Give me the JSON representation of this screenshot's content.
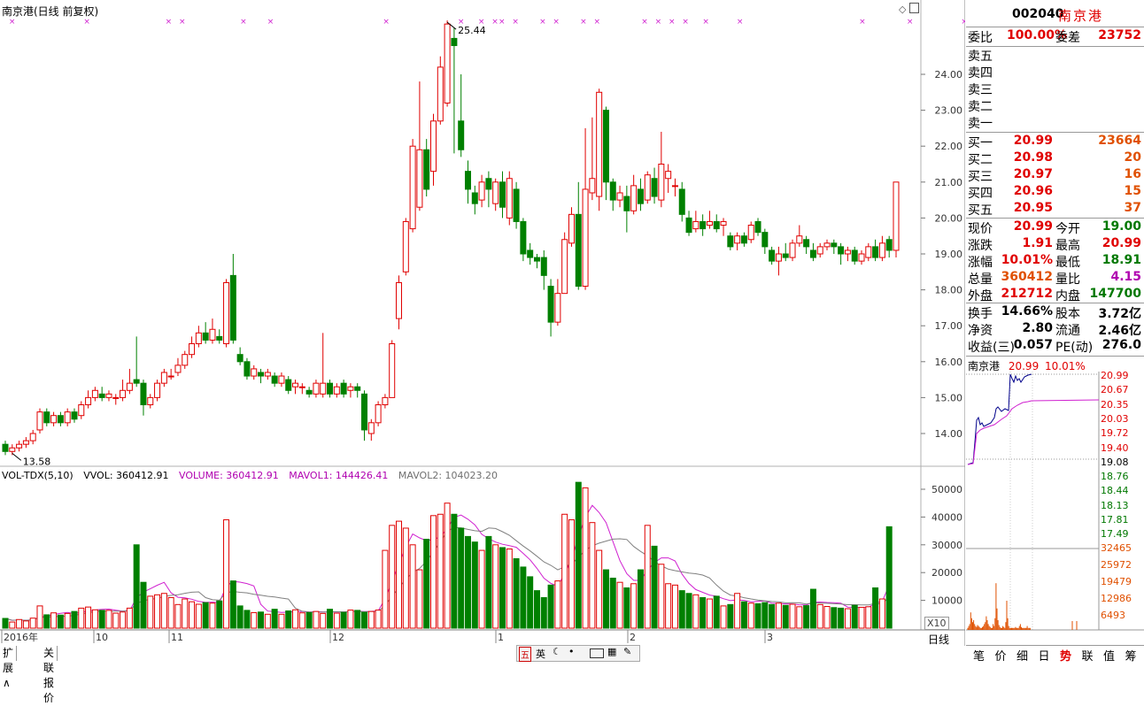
{
  "header": {
    "title": "南京港(日线 前复权)",
    "top_right_icons": [
      "diamond-icon",
      "window-icon"
    ]
  },
  "price_axis": [
    "24.00",
    "23.00",
    "22.00",
    "21.00",
    "20.00",
    "19.00",
    "18.00",
    "17.00",
    "16.00",
    "15.00",
    "14.00"
  ],
  "annotations": {
    "high": "25.44",
    "low": "13.58"
  },
  "volume_header": {
    "name": "VOL-TDX(5,10)",
    "vvol": "VVOL: 360412.91",
    "volume": "VOLUME: 360412.91",
    "mavol1": "MAVOL1: 144426.41",
    "mavol2": "MAVOL2: 104023.20"
  },
  "volume_axis": [
    "50000",
    "40000",
    "30000",
    "20000",
    "10000"
  ],
  "volume_unit": "X10",
  "date_axis": [
    "2016年",
    "10",
    "11",
    "12",
    "1",
    "2",
    "3"
  ],
  "period_label": "日线",
  "bottom_tabs": [
    "扩展∧",
    "关联报价"
  ],
  "toolbar_icons": [
    "五",
    "英"
  ],
  "chart_data": {
    "type": "candlestick",
    "title": "南京港(日线 前复权)",
    "ylim": [
      13.3,
      25.6
    ],
    "candles": [
      [
        13.7,
        13.5,
        13.8,
        13.4
      ],
      [
        13.5,
        13.6,
        13.7,
        13.4
      ],
      [
        13.6,
        13.7,
        13.8,
        13.5
      ],
      [
        13.7,
        13.8,
        13.9,
        13.6
      ],
      [
        13.8,
        14.0,
        14.1,
        13.7
      ],
      [
        14.1,
        14.6,
        14.7,
        14.0
      ],
      [
        14.6,
        14.3,
        14.7,
        14.2
      ],
      [
        14.3,
        14.5,
        14.6,
        14.2
      ],
      [
        14.5,
        14.3,
        14.6,
        14.2
      ],
      [
        14.3,
        14.6,
        14.7,
        14.2
      ],
      [
        14.6,
        14.4,
        14.7,
        14.3
      ],
      [
        14.5,
        14.8,
        14.9,
        14.4
      ],
      [
        14.8,
        15.0,
        15.2,
        14.7
      ],
      [
        15.0,
        15.2,
        15.3,
        14.9
      ],
      [
        15.1,
        15.0,
        15.3,
        14.9
      ],
      [
        15.0,
        15.1,
        15.2,
        14.9
      ],
      [
        15.0,
        15.0,
        15.1,
        14.8
      ],
      [
        15.0,
        15.2,
        15.5,
        14.9
      ],
      [
        15.2,
        15.4,
        15.8,
        15.1
      ],
      [
        15.5,
        15.4,
        16.7,
        15.3
      ],
      [
        15.4,
        14.8,
        15.5,
        14.5
      ],
      [
        14.8,
        15.0,
        15.1,
        14.7
      ],
      [
        15.0,
        15.4,
        15.5,
        14.9
      ],
      [
        15.4,
        15.7,
        15.8,
        15.3
      ],
      [
        15.6,
        15.6,
        15.8,
        15.5
      ],
      [
        15.7,
        15.9,
        16.1,
        15.6
      ],
      [
        15.9,
        16.2,
        16.3,
        15.8
      ],
      [
        16.2,
        16.5,
        16.7,
        16.1
      ],
      [
        16.5,
        16.8,
        17.0,
        16.4
      ],
      [
        16.8,
        16.6,
        17.1,
        16.5
      ],
      [
        16.6,
        16.9,
        17.2,
        16.5
      ],
      [
        16.7,
        16.6,
        16.9,
        16.5
      ],
      [
        16.5,
        18.2,
        18.3,
        16.4
      ],
      [
        18.4,
        16.6,
        19.0,
        16.5
      ],
      [
        16.2,
        16.0,
        16.4,
        15.9
      ],
      [
        16.0,
        15.6,
        16.1,
        15.5
      ],
      [
        15.6,
        15.8,
        15.9,
        15.5
      ],
      [
        15.7,
        15.6,
        15.8,
        15.4
      ],
      [
        15.6,
        15.7,
        15.8,
        15.5
      ],
      [
        15.6,
        15.4,
        15.7,
        15.3
      ],
      [
        15.4,
        15.6,
        15.7,
        15.3
      ],
      [
        15.5,
        15.2,
        15.6,
        15.1
      ],
      [
        15.3,
        15.4,
        15.5,
        15.1
      ],
      [
        15.3,
        15.3,
        15.4,
        15.1
      ],
      [
        15.2,
        15.1,
        15.3,
        15.0
      ],
      [
        15.1,
        15.4,
        15.5,
        15.0
      ],
      [
        15.1,
        15.4,
        16.8,
        15.0
      ],
      [
        15.4,
        15.1,
        15.5,
        15.0
      ],
      [
        15.1,
        15.3,
        15.4,
        15.0
      ],
      [
        15.4,
        15.1,
        15.5,
        15.0
      ],
      [
        15.2,
        15.3,
        15.4,
        15.0
      ],
      [
        15.3,
        15.2,
        15.4,
        15.0
      ],
      [
        15.1,
        14.1,
        15.2,
        13.8
      ],
      [
        14.0,
        14.3,
        14.4,
        13.8
      ],
      [
        14.3,
        14.8,
        14.9,
        14.2
      ],
      [
        14.8,
        15.0,
        15.1,
        14.7
      ],
      [
        15.0,
        16.5,
        16.6,
        15.0
      ],
      [
        17.2,
        18.2,
        18.4,
        16.9
      ],
      [
        18.5,
        19.9,
        20.0,
        18.4
      ],
      [
        19.7,
        22.0,
        22.2,
        19.6
      ],
      [
        20.3,
        21.9,
        23.8,
        20.2
      ],
      [
        21.9,
        20.8,
        22.2,
        20.6
      ],
      [
        21.3,
        22.7,
        22.9,
        20.9
      ],
      [
        22.7,
        24.2,
        24.5,
        22.6
      ],
      [
        23.2,
        25.4,
        25.5,
        23.1
      ],
      [
        25.0,
        24.8,
        25.3,
        21.8
      ],
      [
        22.7,
        21.9,
        24.0,
        21.7
      ],
      [
        21.3,
        20.8,
        21.6,
        20.4
      ],
      [
        20.7,
        20.4,
        20.9,
        20.1
      ],
      [
        20.5,
        21.0,
        21.2,
        20.3
      ],
      [
        21.1,
        20.8,
        21.3,
        20.3
      ],
      [
        20.4,
        21.0,
        21.1,
        20.2
      ],
      [
        21.0,
        20.3,
        21.3,
        20.0
      ],
      [
        20.0,
        21.1,
        21.3,
        19.8
      ],
      [
        20.8,
        19.9,
        21.0,
        19.7
      ],
      [
        19.9,
        19.0,
        20.0,
        18.8
      ],
      [
        19.1,
        18.9,
        19.3,
        18.7
      ],
      [
        18.9,
        18.8,
        19.0,
        18.6
      ],
      [
        18.9,
        18.4,
        19.1,
        18.0
      ],
      [
        18.1,
        17.1,
        18.3,
        16.7
      ],
      [
        17.1,
        17.9,
        18.3,
        17.0
      ],
      [
        17.9,
        19.4,
        19.6,
        17.9
      ],
      [
        19.3,
        20.1,
        20.3,
        19.2
      ],
      [
        20.1,
        18.1,
        21.0,
        18.0
      ],
      [
        18.1,
        20.8,
        22.5,
        18.0
      ],
      [
        20.7,
        21.1,
        22.8,
        20.5
      ],
      [
        20.6,
        23.5,
        23.6,
        20.2
      ],
      [
        23.0,
        21.0,
        23.1,
        20.5
      ],
      [
        21.0,
        20.5,
        21.1,
        20.2
      ],
      [
        20.5,
        20.7,
        20.9,
        20.3
      ],
      [
        20.6,
        20.2,
        20.9,
        19.6
      ],
      [
        20.2,
        20.9,
        21.2,
        20.1
      ],
      [
        20.8,
        20.4,
        21.1,
        20.2
      ],
      [
        20.5,
        21.2,
        21.3,
        20.4
      ],
      [
        21.1,
        20.6,
        21.4,
        20.4
      ],
      [
        20.5,
        21.5,
        22.4,
        20.3
      ],
      [
        21.1,
        21.3,
        21.5,
        20.7
      ],
      [
        20.9,
        20.9,
        21.1,
        20.6
      ],
      [
        20.8,
        20.1,
        21.0,
        19.9
      ],
      [
        20.0,
        19.6,
        20.2,
        19.5
      ],
      [
        19.7,
        19.9,
        20.2,
        19.6
      ],
      [
        19.9,
        19.7,
        20.1,
        19.5
      ],
      [
        19.8,
        19.9,
        20.2,
        19.7
      ],
      [
        19.9,
        19.7,
        20.1,
        19.6
      ],
      [
        19.8,
        19.9,
        20.0,
        19.5
      ],
      [
        19.5,
        19.2,
        19.6,
        19.1
      ],
      [
        19.3,
        19.5,
        19.6,
        19.1
      ],
      [
        19.5,
        19.3,
        19.6,
        19.2
      ],
      [
        19.4,
        19.8,
        19.9,
        19.3
      ],
      [
        19.9,
        19.6,
        20.0,
        19.5
      ],
      [
        19.6,
        19.2,
        19.7,
        19.0
      ],
      [
        19.1,
        18.8,
        19.2,
        18.7
      ],
      [
        18.8,
        19.0,
        19.2,
        18.4
      ],
      [
        19.0,
        18.9,
        19.3,
        18.8
      ],
      [
        18.9,
        19.3,
        19.4,
        18.8
      ],
      [
        19.3,
        19.5,
        19.8,
        19.2
      ],
      [
        19.4,
        19.2,
        19.5,
        19.0
      ],
      [
        19.1,
        18.9,
        19.3,
        18.8
      ],
      [
        19.0,
        19.2,
        19.3,
        18.9
      ],
      [
        19.2,
        19.3,
        19.4,
        19.1
      ],
      [
        19.3,
        19.2,
        19.4,
        19.0
      ],
      [
        19.2,
        19.0,
        19.3,
        18.7
      ],
      [
        19.0,
        19.1,
        19.2,
        18.8
      ],
      [
        19.1,
        18.8,
        19.2,
        18.7
      ],
      [
        18.8,
        19.0,
        19.1,
        18.7
      ],
      [
        18.9,
        19.2,
        19.3,
        18.8
      ],
      [
        19.2,
        18.9,
        19.4,
        18.8
      ],
      [
        18.9,
        19.3,
        19.5,
        18.8
      ],
      [
        19.4,
        19.1,
        19.5,
        18.9
      ],
      [
        19.1,
        21.0,
        21.0,
        18.9
      ]
    ],
    "volume": [
      3500,
      2200,
      3100,
      2600,
      3600,
      8000,
      4800,
      5500,
      4700,
      5300,
      6000,
      7200,
      7600,
      6600,
      6400,
      6400,
      5400,
      5800,
      7200,
      30000,
      16500,
      11500,
      12000,
      12500,
      11000,
      8500,
      10500,
      9500,
      8600,
      9200,
      9000,
      9800,
      39000,
      17000,
      8000,
      6400,
      5600,
      5800,
      5000,
      6800,
      5000,
      6200,
      6600,
      5500,
      5600,
      6000,
      5300,
      6800,
      5400,
      5700,
      6500,
      6400,
      5700,
      6000,
      6500,
      28000,
      37000,
      38500,
      36000,
      30000,
      21000,
      32000,
      40500,
      41000,
      45000,
      41000,
      36000,
      33000,
      31000,
      28000,
      33000,
      30000,
      29000,
      28500,
      25000,
      22000,
      18500,
      13500,
      11000,
      15500,
      17000,
      41000,
      39000,
      52500,
      50500,
      38000,
      28000,
      21000,
      18000,
      16500,
      14500,
      16000,
      21000,
      37000,
      29500,
      23000,
      16000,
      15500,
      13500,
      12500,
      12000,
      11000,
      10500,
      11500,
      8000,
      8500,
      12500,
      9500,
      9000,
      8800,
      9200,
      8500,
      9000,
      8200,
      8600,
      7700,
      8100,
      14000,
      8500,
      7800,
      7400,
      7200,
      7000,
      8200,
      7500,
      7700,
      14500,
      10500,
      36500
    ],
    "x_labels": [
      "2016年",
      "10",
      "11",
      "12",
      "1",
      "2",
      "3"
    ]
  },
  "quote": {
    "code": "002040",
    "name": "南京港",
    "weibi_label": "委比",
    "weibi": "100.00%",
    "weicha_label": "委差",
    "weicha": "23752",
    "sell_labels": [
      "卖五",
      "卖四",
      "卖三",
      "卖二",
      "卖一"
    ],
    "buy": [
      {
        "label": "买一",
        "price": "20.99",
        "vol": "23664"
      },
      {
        "label": "买二",
        "price": "20.98",
        "vol": "20"
      },
      {
        "label": "买三",
        "price": "20.97",
        "vol": "16"
      },
      {
        "label": "买四",
        "price": "20.96",
        "vol": "15"
      },
      {
        "label": "买五",
        "price": "20.95",
        "vol": "37"
      }
    ],
    "stats": [
      {
        "l1": "现价",
        "v1": "20.99",
        "c1": "red",
        "l2": "今开",
        "v2": "19.00",
        "c2": "green"
      },
      {
        "l1": "涨跌",
        "v1": "1.91",
        "c1": "red",
        "l2": "最高",
        "v2": "20.99",
        "c2": "red"
      },
      {
        "l1": "涨幅",
        "v1": "10.01%",
        "c1": "red",
        "l2": "最低",
        "v2": "18.91",
        "c2": "green"
      },
      {
        "l1": "总量",
        "v1": "360412",
        "c1": "orange",
        "l2": "量比",
        "v2": "4.15",
        "c2": "purple"
      },
      {
        "l1": "外盘",
        "v1": "212712",
        "c1": "red",
        "l2": "内盘",
        "v2": "147700",
        "c2": "green"
      }
    ],
    "stats2": [
      {
        "l1": "换手",
        "v1": "14.66%",
        "l2": "股本",
        "v2": "3.72亿"
      },
      {
        "l1": "净资",
        "v1": "2.80",
        "l2": "流通",
        "v2": "2.46亿"
      },
      {
        "l1": "收益(三)",
        "v1": "0.057",
        "l2": "PE(动)",
        "v2": "276.0"
      }
    ]
  },
  "mini_chart": {
    "title_name": "南京港",
    "title_price": "20.99",
    "title_pct": "10.01%",
    "price_labels": [
      "20.99",
      "20.67",
      "20.35",
      "20.03",
      "19.72",
      "19.40",
      "19.08",
      "18.76",
      "18.44",
      "18.13",
      "17.81",
      "17.49"
    ],
    "volume_labels": [
      "32465",
      "25972",
      "19479",
      "12986",
      "6493"
    ]
  },
  "right_tabs": [
    "笔",
    "价",
    "细",
    "日",
    "势",
    "联",
    "值",
    "筹"
  ]
}
